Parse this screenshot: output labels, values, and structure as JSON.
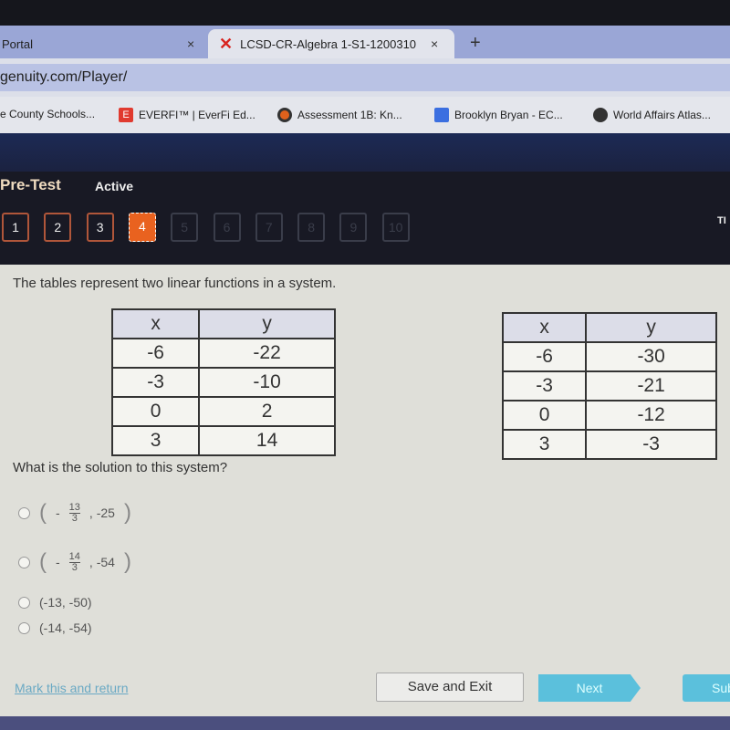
{
  "browser": {
    "tabs": [
      {
        "label": "Portal"
      },
      {
        "label": "LCSD-CR-Algebra 1-S1-1200310",
        "active": true
      }
    ],
    "close_glyph": "×",
    "new_tab": "+",
    "url": "genuity.com/Player/",
    "bookmarks": [
      {
        "label": "e County Schools...",
        "icon": ""
      },
      {
        "label": "EVERFI™ | EverFi Ed...",
        "icon": "E",
        "color": "#e03a2f"
      },
      {
        "label": "Assessment 1B: Kn...",
        "icon": "",
        "color": "#e0611c"
      },
      {
        "label": "Brooklyn Bryan - EC...",
        "icon": "",
        "color": "#3b6fe0"
      },
      {
        "label": "World Affairs Atlas...",
        "icon": "globe-icon"
      }
    ]
  },
  "header": {
    "title": "Pre-Test",
    "status": "Active",
    "timer_label": "TI",
    "questions": [
      "1",
      "2",
      "3",
      "4",
      "5",
      "6",
      "7",
      "8",
      "9",
      "10"
    ],
    "current": 4
  },
  "question": {
    "prompt": "The tables represent two linear functions in a system.",
    "table1": {
      "headers": [
        "x",
        "y"
      ],
      "rows": [
        [
          "-6",
          "-22"
        ],
        [
          "-3",
          "-10"
        ],
        [
          "0",
          "2"
        ],
        [
          "3",
          "14"
        ]
      ]
    },
    "table2": {
      "headers": [
        "x",
        "y"
      ],
      "rows": [
        [
          "-6",
          "-30"
        ],
        [
          "-3",
          "-21"
        ],
        [
          "0",
          "-12"
        ],
        [
          "3",
          "-3"
        ]
      ]
    },
    "sub": "What is the solution to this system?",
    "options": [
      {
        "neg": "-",
        "num": "13",
        "den": "3",
        "y": ", -25"
      },
      {
        "neg": "-",
        "num": "14",
        "den": "3",
        "y": ", -54"
      },
      {
        "text": "(-13, -50)"
      },
      {
        "text": "(-14, -54)"
      }
    ]
  },
  "footer": {
    "mark": "Mark this and return",
    "save": "Save and Exit",
    "next": "Next",
    "submit": "Sub"
  }
}
